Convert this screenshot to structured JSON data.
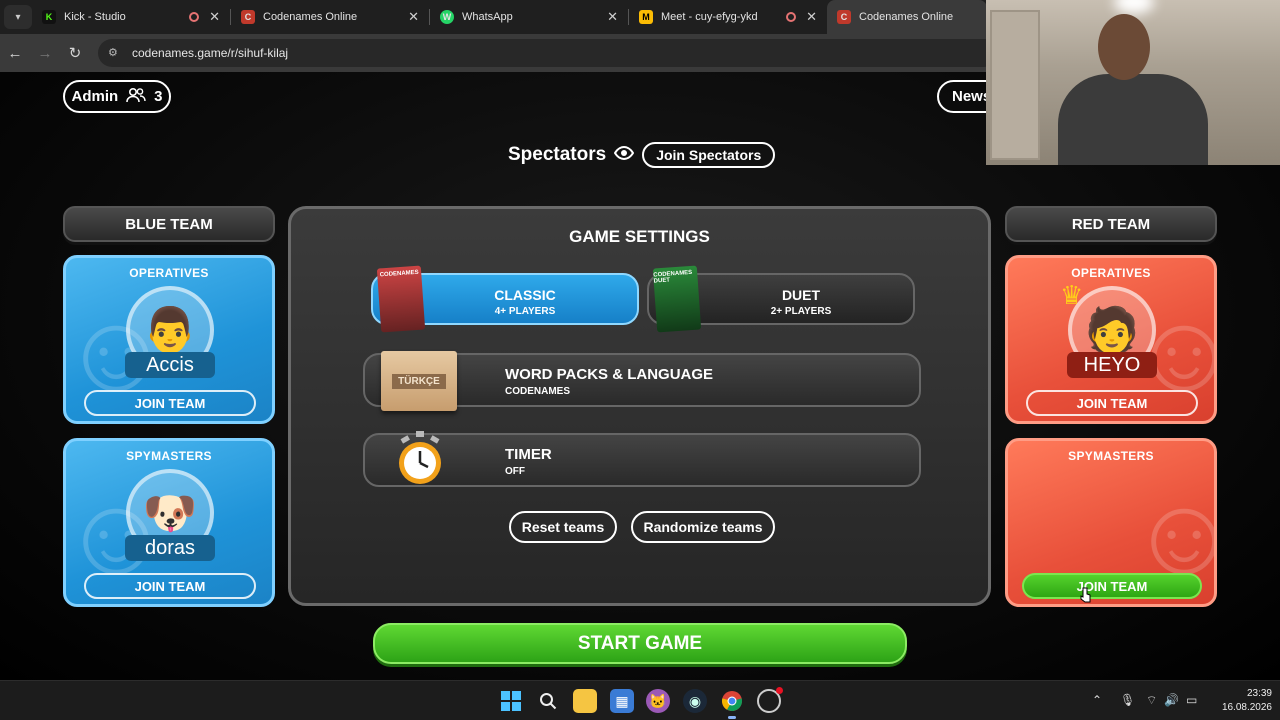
{
  "browser": {
    "tabs": [
      {
        "title": "Kick - Studio",
        "favicon": "K",
        "color": "#53fc18",
        "recording": true
      },
      {
        "title": "Codenames Online",
        "favicon": "C",
        "color": "#c0392b",
        "recording": false
      },
      {
        "title": "WhatsApp",
        "favicon": "W",
        "color": "#25d366",
        "recording": false
      },
      {
        "title": "Meet - cuy-efyg-ykd",
        "favicon": "M",
        "color": "#fbbc04",
        "recording": true
      },
      {
        "title": "Codenames Online",
        "favicon": "C",
        "color": "#c0392b",
        "recording": false
      }
    ],
    "url": "codenames.game/r/sihuf-kilaj"
  },
  "game": {
    "admin": {
      "label": "Admin",
      "count": "3"
    },
    "news_label": "News",
    "spectators_label": "Spectators",
    "join_spectators": "Join Spectators",
    "blue_team": {
      "header": "BLUE TEAM",
      "operatives": {
        "role": "OPERATIVES",
        "player": "Accis",
        "join": "JOIN TEAM"
      },
      "spymasters": {
        "role": "SPYMASTERS",
        "player": "doras",
        "join": "JOIN TEAM"
      }
    },
    "red_team": {
      "header": "RED TEAM",
      "operatives": {
        "role": "OPERATIVES",
        "player": "HEYO",
        "join": "JOIN TEAM"
      },
      "spymasters": {
        "role": "SPYMASTERS",
        "join": "JOIN TEAM"
      }
    },
    "settings": {
      "title": "GAME SETTINGS",
      "modes": [
        {
          "name": "CLASSIC",
          "players": "4+ PLAYERS",
          "selected": true,
          "box_label": "CODENAMES"
        },
        {
          "name": "DUET",
          "players": "2+ PLAYERS",
          "selected": false,
          "box_label": "CODENAMES DUET"
        }
      ],
      "word_packs": {
        "title": "WORD PACKS & LANGUAGE",
        "value": "CODENAMES",
        "language_card": "TÜRKÇE"
      },
      "timer": {
        "title": "TIMER",
        "value": "OFF"
      },
      "reset_label": "Reset teams",
      "randomize_label": "Randomize teams"
    },
    "start_label": "START GAME"
  },
  "taskbar": {
    "time": "23:39",
    "date": "16.08.2026"
  },
  "colors": {
    "blue_card": "#1f93d8",
    "red_card": "#e8503a",
    "green_button": "#2ea613"
  }
}
